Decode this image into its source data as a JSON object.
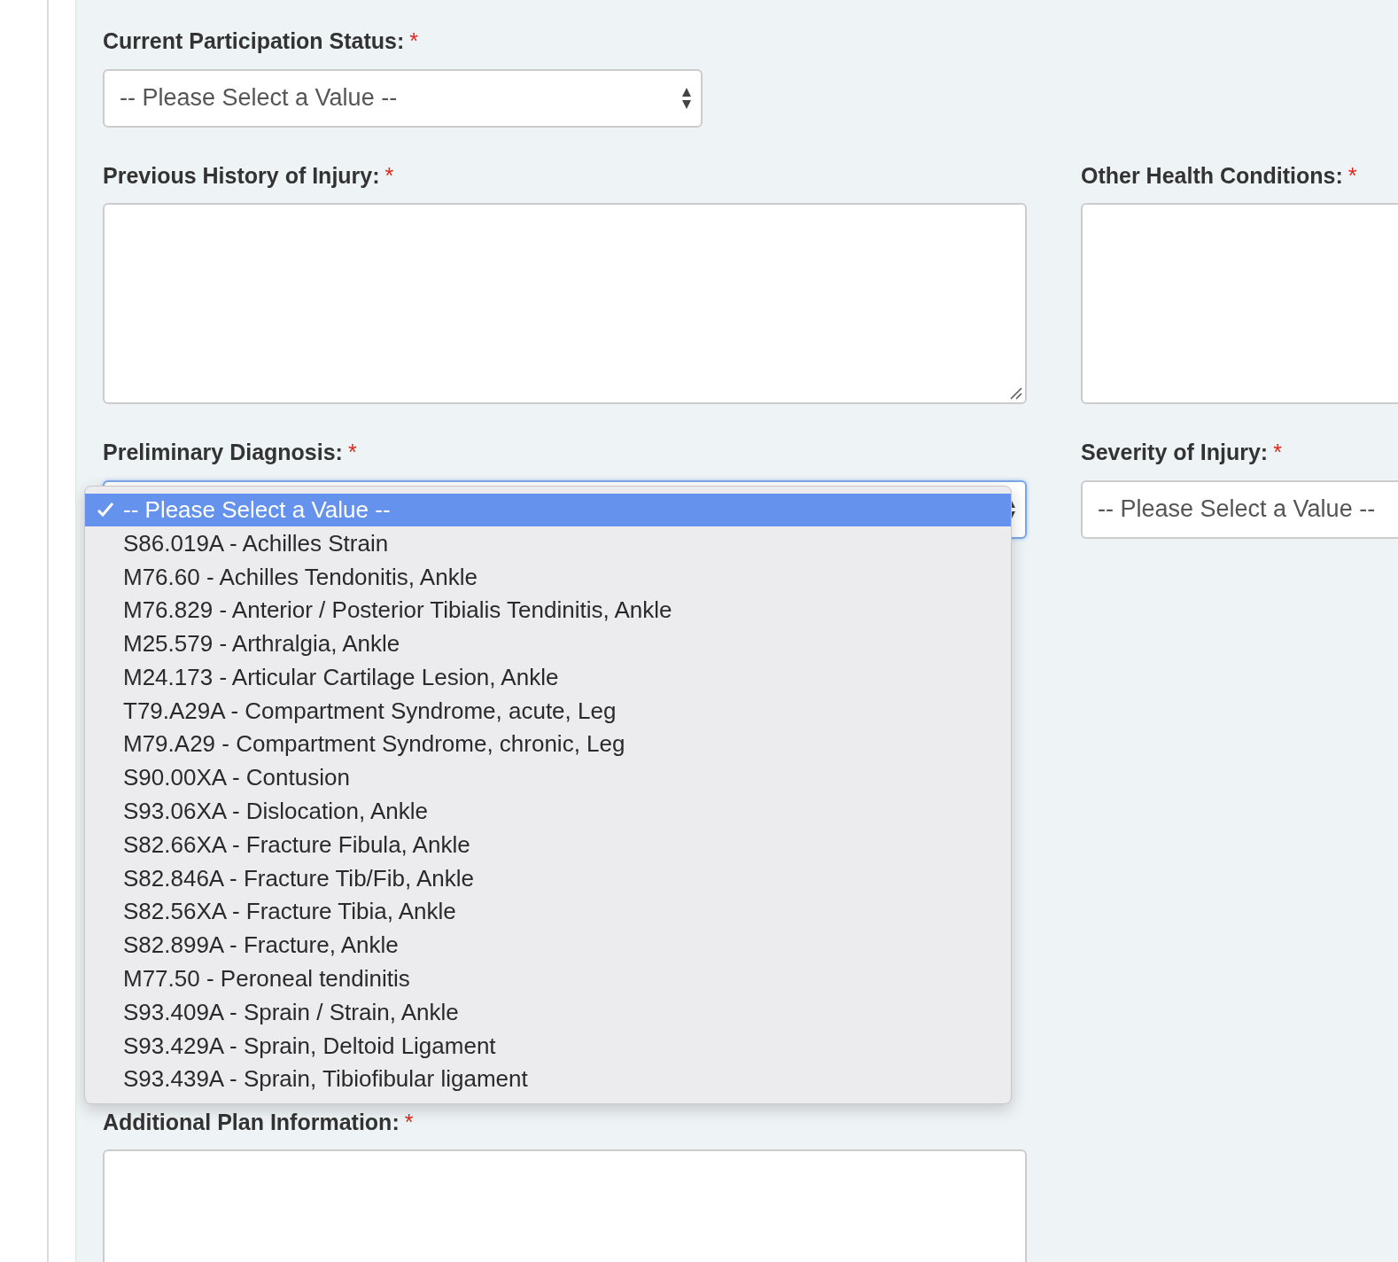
{
  "rows": [
    [
      {
        "label": "Current Participation Status:",
        "required_mark": "*",
        "kind": "select",
        "value": "-- Please Select a Value --"
      }
    ],
    [
      {
        "label": "Previous History of Injury:",
        "required_mark": "*",
        "kind": "textarea"
      },
      {
        "label": "Other Health Conditions:",
        "required_mark": "*",
        "kind": "textarea"
      }
    ],
    [
      {
        "label": "Preliminary Diagnosis:",
        "required_mark": "*",
        "kind": "select",
        "open": true
      },
      {
        "label": "Severity of Injury:",
        "required_mark": "*",
        "kind": "select",
        "value": "-- Please Select a Value --"
      }
    ],
    [
      {
        "label": "Additional Plan Information:",
        "required_mark": "*",
        "kind": "textarea"
      }
    ]
  ],
  "dropdown": {
    "options": [
      {
        "label": "-- Please Select a Value --",
        "selected": true
      },
      {
        "label": "S86.019A - Achilles Strain",
        "selected": false
      },
      {
        "label": "M76.60 - Achilles Tendonitis, Ankle",
        "selected": false
      },
      {
        "label": "M76.829 - Anterior / Posterior Tibialis Tendinitis, Ankle",
        "selected": false
      },
      {
        "label": "M25.579 - Arthralgia, Ankle",
        "selected": false
      },
      {
        "label": "M24.173 - Articular Cartilage Lesion, Ankle",
        "selected": false
      },
      {
        "label": "T79.A29A - Compartment Syndrome, acute, Leg",
        "selected": false
      },
      {
        "label": "M79.A29 - Compartment Syndrome, chronic, Leg",
        "selected": false
      },
      {
        "label": "S90.00XA - Contusion",
        "selected": false
      },
      {
        "label": "S93.06XA - Dislocation, Ankle",
        "selected": false
      },
      {
        "label": "S82.66XA - Fracture Fibula, Ankle",
        "selected": false
      },
      {
        "label": "S82.846A - Fracture Tib/Fib, Ankle",
        "selected": false
      },
      {
        "label": "S82.56XA - Fracture Tibia, Ankle",
        "selected": false
      },
      {
        "label": "S82.899A - Fracture, Ankle",
        "selected": false
      },
      {
        "label": "M77.50 - Peroneal tendinitis",
        "selected": false
      },
      {
        "label": "S93.409A - Sprain / Strain, Ankle",
        "selected": false
      },
      {
        "label": "S93.429A - Sprain, Deltoid Ligament",
        "selected": false
      },
      {
        "label": "S93.439A - Sprain, Tibiofibular ligament",
        "selected": false
      }
    ]
  }
}
